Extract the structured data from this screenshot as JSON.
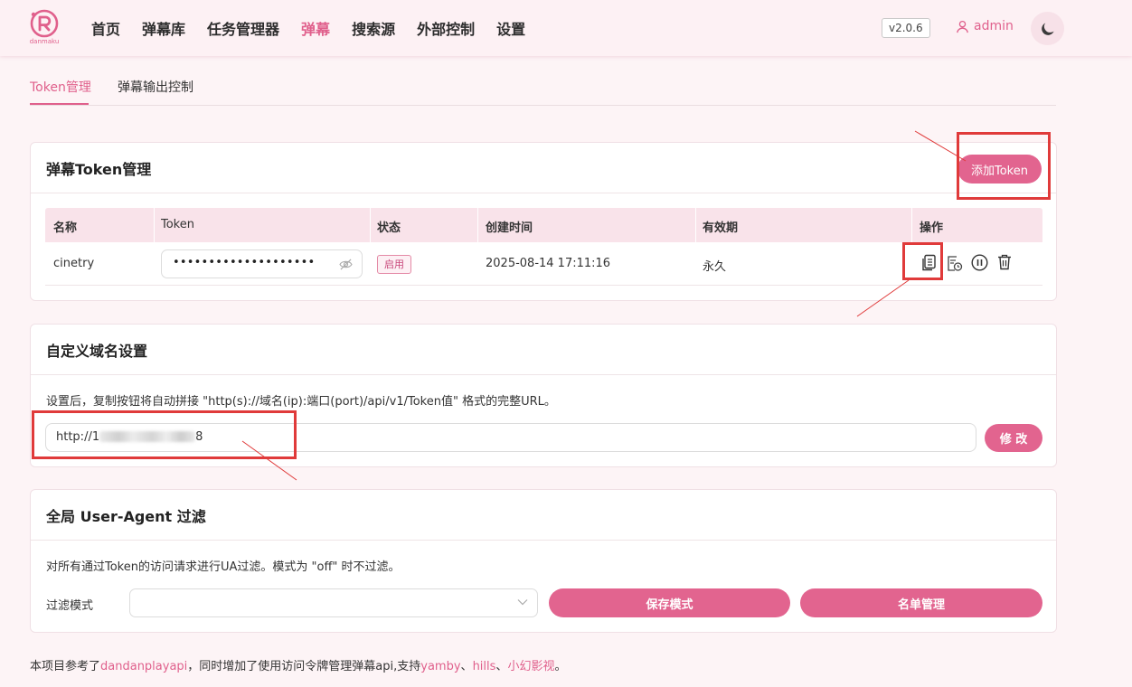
{
  "app": {
    "logo_text": "danmaku",
    "version": "v2.0.6",
    "user": "admin"
  },
  "nav": [
    {
      "label": "首页"
    },
    {
      "label": "弹幕库"
    },
    {
      "label": "任务管理器"
    },
    {
      "label": "弹幕"
    },
    {
      "label": "搜索源"
    },
    {
      "label": "外部控制"
    },
    {
      "label": "设置"
    }
  ],
  "tabs": [
    "Token管理",
    "弹幕输出控制"
  ],
  "token_card": {
    "title": "弹幕Token管理",
    "add_button": "添加Token",
    "columns": [
      "名称",
      "Token",
      "状态",
      "创建时间",
      "有效期",
      "操作"
    ],
    "rows": [
      {
        "name": "cinetry",
        "token_masked": "••••••••••••••••••••",
        "status": "启用",
        "created": "2025-08-14 17:11:16",
        "validity": "永久"
      }
    ]
  },
  "domain_card": {
    "title": "自定义域名设置",
    "hint": "设置后，复制按钮将自动拼接 \"http(s)://域名(ip):端口(port)/api/v1/Token值\" 格式的完整URL。",
    "url_prefix": "http://1",
    "url_suffix": "8",
    "modify_button": "修 改"
  },
  "ua_card": {
    "title": "全局 User-Agent 过滤",
    "hint": "对所有通过Token的访问请求进行UA过滤。模式为 \"off\" 时不过滤。",
    "mode_label": "过滤模式",
    "mode_value": "",
    "save_button": "保存模式",
    "list_button": "名单管理"
  },
  "footer": {
    "prefix": "本项目参考了",
    "link1": "dandanplayapi",
    "middle": "，同时增加了使用访问令牌管理弹幕api,支持",
    "link2": "yamby",
    "sep1": "、",
    "link3": "hills",
    "sep2": "、",
    "link4": "小幻影视",
    "end": "。"
  },
  "colors": {
    "accent": "#e2648f",
    "annotation": "#e03a3a"
  }
}
